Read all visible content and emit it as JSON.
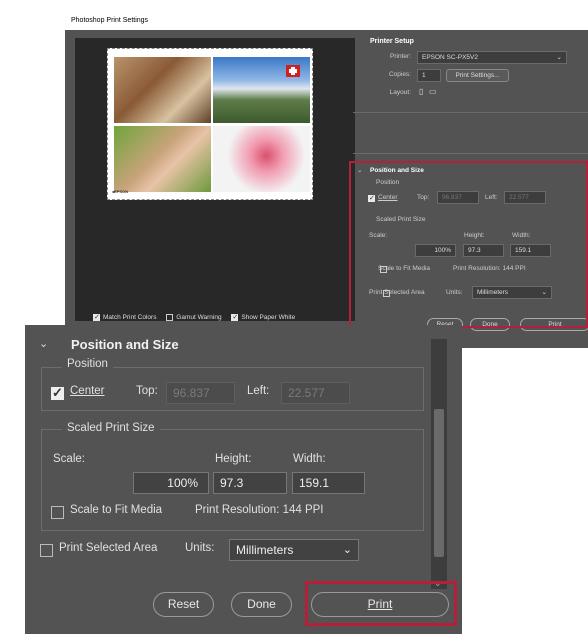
{
  "window_title": "Photoshop Print Settings",
  "printer_setup": {
    "heading": "Printer Setup",
    "printer_label": "Printer:",
    "printer_value": "EPSON SC-PX5V2",
    "copies_label": "Copies:",
    "copies_value": "1",
    "print_settings_button": "Print Settings...",
    "layout_label": "Layout:"
  },
  "preview_options": {
    "match_print_colors": "Match Print Colors",
    "gamut_warning": "Gamut Warning",
    "show_paper_white": "Show Paper White"
  },
  "position_and_size": {
    "heading": "Position and Size",
    "position_label": "Position",
    "center_label": "Center",
    "center_checked": true,
    "top_label": "Top:",
    "top_value": "96.837",
    "left_label": "Left:",
    "left_value": "22.577",
    "scaled_print_size_label": "Scaled Print Size",
    "scale_label": "Scale:",
    "scale_value": "100%",
    "height_label": "Height:",
    "height_value": "97.3",
    "width_label": "Width:",
    "width_value": "159.1",
    "scale_to_fit_label": "Scale to Fit Media",
    "scale_to_fit_checked": false,
    "print_resolution": "Print Resolution: 144 PPI",
    "print_selected_area_label": "Print Selected Area",
    "print_selected_area_checked": false,
    "units_label": "Units:",
    "units_value": "Millimeters"
  },
  "buttons": {
    "reset": "Reset",
    "done": "Done",
    "print": "Print"
  },
  "colors": {
    "panel": "#535353",
    "highlight": "#b51f3a"
  }
}
